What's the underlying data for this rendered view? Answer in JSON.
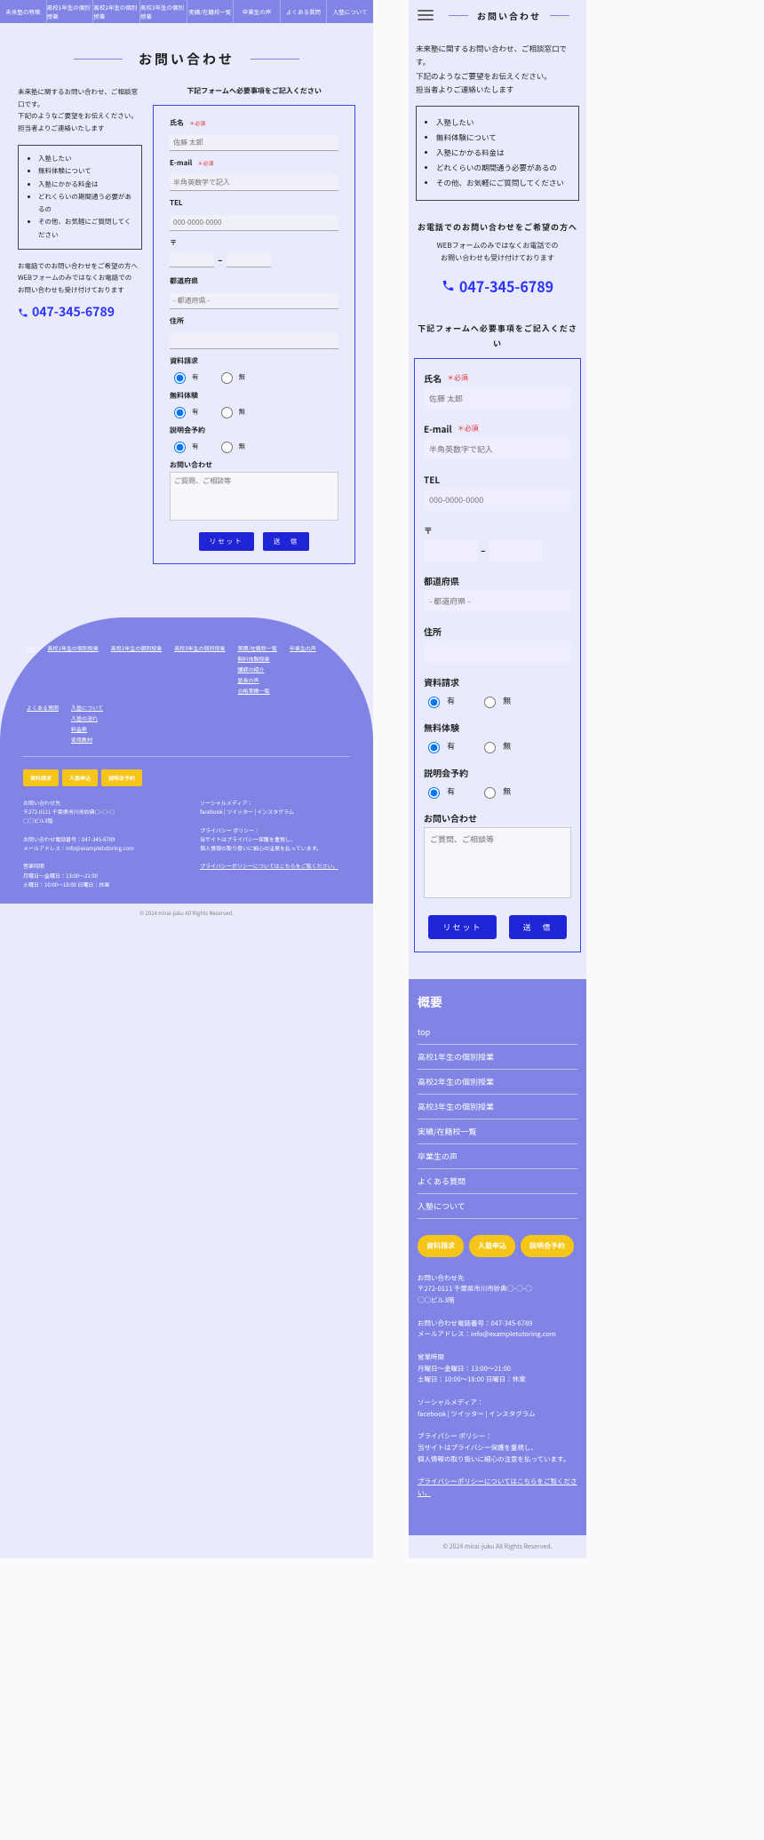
{
  "nav": [
    "未来塾の特徴",
    "高校1年生の個別授業",
    "高校2年生の個別授業",
    "高校3年生の個別授業",
    "実績/在籍校一覧",
    "卒業生の声",
    "よくある質問",
    "入塾について"
  ],
  "page_heading": "お問い合わせ",
  "intro": [
    "未来塾に関するお問い合わせ、ご相談窓口です。",
    "下記のようなご要望をお伝えください。",
    "担当者よりご連絡いたします"
  ],
  "list": [
    "入塾したい",
    "無料体験について",
    "入塾にかかる料金は",
    "どれくらいの期間通う必要があるの",
    "その他、お気軽にご質問してください"
  ],
  "tel": {
    "head": "お電話でのお問い合わせをご希望の方へ",
    "sub1": "WEBフォームのみではなくお電話での",
    "sub2": "お問い合わせも受け付けております",
    "number": "047-345-6789"
  },
  "form": {
    "title": "下記フォームへ必要事項をご記入ください",
    "required": "＊必須",
    "name_lbl": "氏名",
    "name_ph": "佐藤 太郎",
    "email_lbl": "E-mail",
    "email_ph": "半角英数字で記入",
    "tel_lbl": "TEL",
    "tel_ph": "000-0000-0000",
    "zip_lbl": "〒",
    "pref_lbl": "都道府県",
    "pref_ph": "- 都道府県 -",
    "addr_lbl": "住所",
    "req_doc_lbl": "資料請求",
    "trial_lbl": "無料体験",
    "briefing_lbl": "説明会予約",
    "radio_yes": "有",
    "radio_no": "無",
    "inquiry_lbl": "お問い合わせ",
    "inquiry_ph": "ご質問、ご相談等",
    "reset": "リセット",
    "submit": "送　信"
  },
  "footer": {
    "top": "top",
    "links": [
      "高校1年生の個別授業",
      "高校2年生の個別授業",
      "高校3年生の個別授業",
      "実績/在籍校一覧",
      "卒業生の声",
      "よくある質問",
      "入塾について"
    ],
    "sublinks": [
      "無料体験授業",
      "講師の紹介",
      "塾長の声",
      "合格実績一覧",
      "入塾の流れ",
      "料金表",
      "使用教材"
    ],
    "overview": "概要",
    "ybtn": [
      "資料請求",
      "入塾申込",
      "説明会予約"
    ],
    "contact_head": "お問い合わせ先",
    "addr1": "〒272-0111 千葉県市川市妙典○-○-○",
    "addr2": "○○ビル3階",
    "phone_lbl": "お問い合わせ電話番号：047-345-6789",
    "mail_lbl": "メールアドレス：info@exampletutoring.com",
    "hours_head": "営業時間",
    "hours1": "月曜日～金曜日：13:00～21:00",
    "hours2": "土曜日：10:00～18:00 日曜日：休業",
    "social_head": "ソーシャルメディア：",
    "social": "facebook | ツイッター | インスタグラム",
    "privacy_head": "プライバシー ポリシー：",
    "privacy1": "当サイトはプライバシー保護を重視し、",
    "privacy2": "個人情報の取り扱いに細心の注意を払っています。",
    "privacy_link": "プライバシーポリシーについてはこちらをご覧ください。",
    "copyright": "© 2024 mirai-juku All Rights Reserved."
  }
}
